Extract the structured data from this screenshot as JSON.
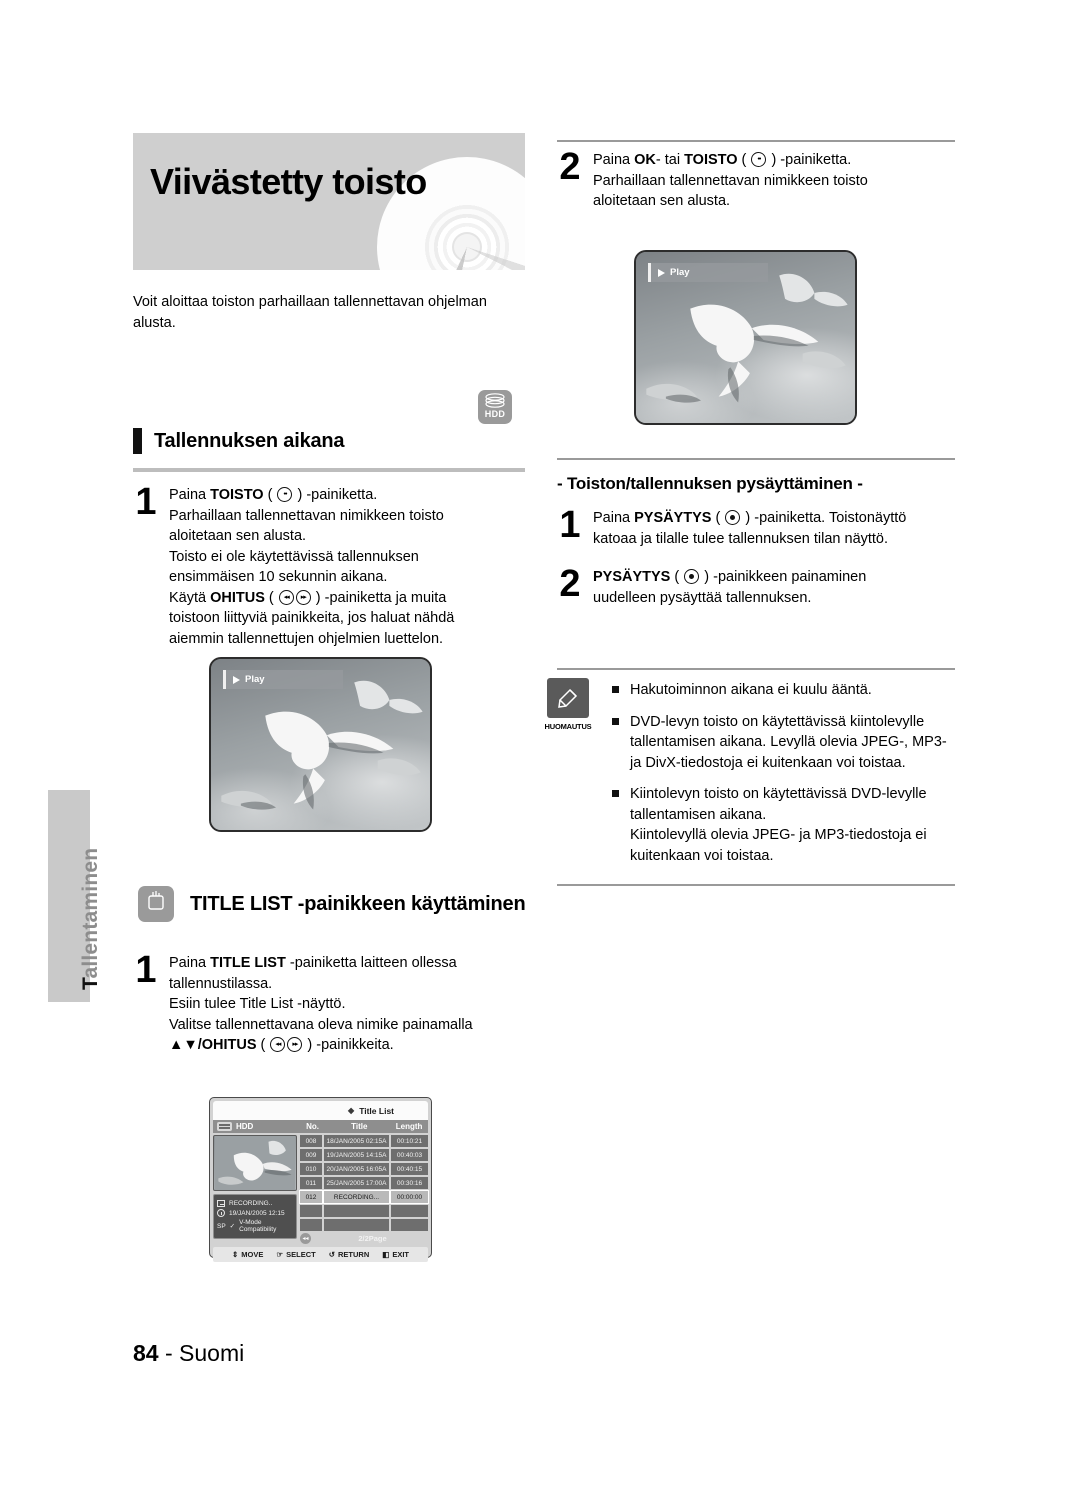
{
  "sidebar": {
    "tab_label": "Tallentaminen"
  },
  "banner": {
    "title": "Viivästetty toisto",
    "disc_icon": "dvd-disc-icon"
  },
  "intro": {
    "text": "Voit aloittaa toiston parhaillaan tallennettavan ohjelman alusta."
  },
  "left": {
    "media_badge": {
      "label": "HDD",
      "icon": "hdd-icon"
    },
    "section1": {
      "heading": "Tallennuksen aikana",
      "steps": [
        {
          "num": "1",
          "lines": [
            {
              "pre": "Paina ",
              "strong": "TOISTO",
              "mid": " ( ",
              "icon": "play-button-icon",
              "post": " ) -painiketta."
            },
            {
              "pre": "Parhaillaan tallennettavan nimikkeen toisto"
            },
            {
              "pre": "aloitetaan sen alusta."
            },
            {
              "pre": "Toisto ei ole käytettävissä tallennuksen"
            },
            {
              "pre": "ensimmäisen 10 sekunnin aikana."
            },
            {
              "pre": "Käytä ",
              "strong": "OHITUS",
              "mid": " ( ",
              "icon": "skip-back-icon",
              "icon2": "skip-forward-icon",
              "post": " ) -painiketta ja muita"
            },
            {
              "pre": "toistoon liittyviä painikkeita, jos haluat nähdä"
            },
            {
              "pre": "aiemmin tallennettujen ohjelmien luettelon."
            }
          ]
        }
      ],
      "screenshot": {
        "overlay_label": "Play",
        "alt": "seagulls-playback-screenshot"
      }
    },
    "section2": {
      "badge_icon": "title-list-button-icon",
      "heading": "TITLE LIST -painikkeen käyttäminen",
      "steps": [
        {
          "num": "1",
          "lines": [
            {
              "pre": "Paina ",
              "strong": "TITLE LIST",
              "post": " -painiketta laitteen ollessa"
            },
            {
              "pre": "tallennustilassa."
            },
            {
              "pre": "Esiin tulee Title List -näyttö."
            },
            {
              "pre": "Valitse tallennettavana oleva nimike painamalla"
            },
            {
              "strong": "▲▼/OHITUS",
              "mid": " ( ",
              "icon": "skip-back-icon",
              "icon2": "skip-forward-icon",
              "post": " ) -painikkeita."
            }
          ]
        }
      ]
    }
  },
  "osd": {
    "title": "Title List",
    "source_label": "HDD",
    "source_icon": "hdd-chip-icon",
    "columns": [
      "No.",
      "Title",
      "Length"
    ],
    "rows": [
      {
        "no": "008",
        "title": "18/JAN/2005 02:15A",
        "length": "00:10:21",
        "selected": false
      },
      {
        "no": "009",
        "title": "19/JAN/2005 14:15A",
        "length": "00:40:03",
        "selected": false
      },
      {
        "no": "010",
        "title": "20/JAN/2005 16:05A",
        "length": "00:40:15",
        "selected": false
      },
      {
        "no": "011",
        "title": "25/JAN/2005 17:00A",
        "length": "00:30:16",
        "selected": false
      },
      {
        "no": "012",
        "title": "RECORDING...",
        "length": "00:00:00",
        "selected": true
      }
    ],
    "empty_rows": 2,
    "info": {
      "name": "RECORDING..",
      "datetime": "19/JAN/2005 12:15",
      "mode": "SP",
      "compat": "V-Mode Compatibility"
    },
    "page": "2/2Page",
    "page_arrow_icon": "page-prev-icon",
    "footer": [
      {
        "icon": "updown-arrow-icon",
        "label": "MOVE"
      },
      {
        "icon": "enter-icon",
        "label": "SELECT"
      },
      {
        "icon": "return-icon",
        "label": "RETURN"
      },
      {
        "icon": "exit-icon",
        "label": "EXIT"
      }
    ]
  },
  "right": {
    "step2": {
      "num": "2",
      "lines": [
        {
          "pre": "Paina ",
          "strong": "OK",
          "mid2": "- tai ",
          "strong2": "TOISTO",
          "mid": " ( ",
          "icon": "play-button-icon",
          "post": " ) -painiketta."
        },
        {
          "pre": "Parhaillaan tallennettavan nimikkeen toisto"
        },
        {
          "pre": "aloitetaan sen alusta."
        }
      ],
      "screenshot": {
        "overlay_label": "Play",
        "alt": "seagulls-playback-screenshot"
      }
    },
    "stopsection": {
      "heading": "- Toiston/tallennuksen pysäyttäminen -",
      "steps": [
        {
          "num": "1",
          "lines": [
            {
              "pre": "Paina ",
              "strong": "PYSÄYTYS",
              "mid": " ( ",
              "icon": "stop-button-icon",
              "post": " ) -painiketta. Toistonäyttö"
            },
            {
              "pre": "katoaa ja tilalle tulee tallennuksen tilan näyttö."
            }
          ]
        },
        {
          "num": "2",
          "lines": [
            {
              "strong": "PYSÄYTYS",
              "mid": " ( ",
              "icon": "stop-button-icon",
              "post": " ) -painikkeen painaminen"
            },
            {
              "pre": "uudelleen pysäyttää tallennuksen."
            }
          ]
        }
      ]
    },
    "note": {
      "icon": "pencil-note-icon",
      "caption": "HUOMAUTUS",
      "items": [
        "Hakutoiminnon aikana ei kuulu ääntä.",
        "DVD-levyn toisto on käytettävissä kiintolevylle tallentamisen aikana. Levyllä olevia JPEG-, MP3- ja DivX-tiedostoja ei kuitenkaan voi toistaa.",
        "Kiintolevyn toisto on käytettävissä DVD-levylle tallentamisen aikana.\nKiintolevyllä olevia JPEG- ja MP3-tiedostoja ei kuitenkaan voi toistaa."
      ]
    }
  },
  "footer": {
    "page_number": "84",
    "separator": " - ",
    "language": "Suomi"
  },
  "colors": {
    "banner_bg": "#cfcfcf",
    "rule": "#bdbdbd",
    "tab_bg": "#c9c9c9",
    "badge_bg": "#9a9a9a"
  }
}
